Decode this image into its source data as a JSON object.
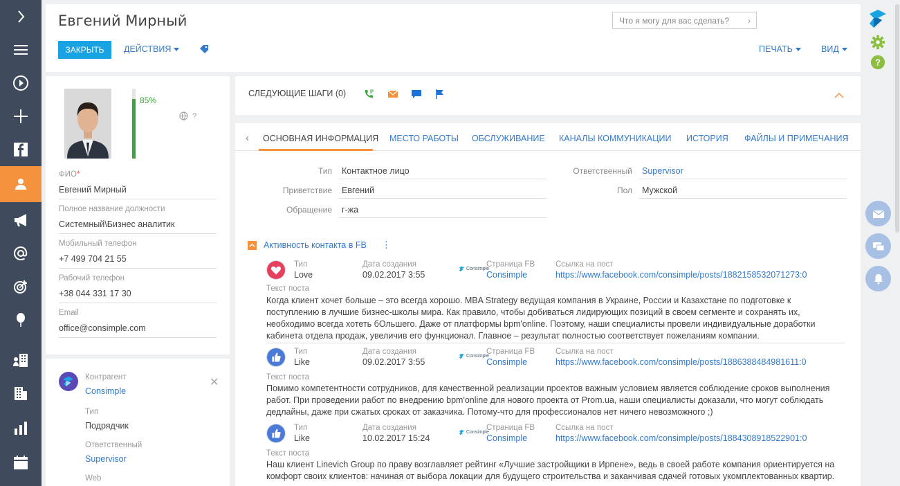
{
  "nav": {
    "items": [
      "expand",
      "menu",
      "processes",
      "add",
      "facebook",
      "contacts",
      "campaigns",
      "email",
      "targets",
      "leads",
      "accounts",
      "buildings",
      "dashboards",
      "calendar"
    ]
  },
  "header": {
    "title": "Евгений Мирный",
    "close_label": "ЗАКРЫТЬ",
    "actions_label": "ДЕЙСТВИЯ",
    "print_label": "ПЕЧАТЬ",
    "view_label": "ВИД",
    "search_placeholder": "Что я могу для вас сделать?"
  },
  "profile": {
    "completeness_pct": 85,
    "completeness_label": "85%",
    "help": "?",
    "fields": [
      {
        "label": "ФИО",
        "required": "*",
        "value": "Евгений Мирный"
      },
      {
        "label": "Полное название должности",
        "value": "Системный\\Бизнес аналитик"
      },
      {
        "label": "Мобильный телефон",
        "value": "+7 499 704 21 55"
      },
      {
        "label": "Рабочий телефон",
        "value": "+38 044 331 17 30"
      },
      {
        "label": "Email",
        "value": "office@consimple.com"
      }
    ]
  },
  "account": {
    "label": "Контрагент",
    "name": "Consimple",
    "type_label": "Тип",
    "type_value": "Подрядчик",
    "owner_label": "Ответственный",
    "owner_value": "Supervisor",
    "web_label": "Web"
  },
  "next_steps": {
    "title": "СЛЕДУЮЩИЕ ШАГИ (0)",
    "icons": [
      "call-icon",
      "email-icon",
      "chat-icon",
      "flag-icon"
    ]
  },
  "tabs": [
    "ОСНОВНАЯ ИНФОРМАЦИЯ",
    "МЕСТО РАБОТЫ",
    "ОБСЛУЖИВАНИЕ",
    "КАНАЛЫ КОММУНИКАЦИИ",
    "ИСТОРИЯ",
    "ФАЙЛЫ И ПРИМЕЧАНИЯ"
  ],
  "info": {
    "type_label": "Тип",
    "type_value": "Контактное лицо",
    "greeting_label": "Приветствие",
    "greeting_value": "Евгений",
    "salutation_label": "Обращение",
    "salutation_value": "г-жа",
    "owner_label": "Ответственный",
    "owner_value": "Supervisor",
    "gender_label": "Пол",
    "gender_value": "Мужской"
  },
  "fb_section": {
    "title": "Активность контакта в FB",
    "col_type": "Тип",
    "col_date": "Дата создания",
    "col_page": "Страница FB",
    "col_link": "Ссылка на пост",
    "col_text": "Текст поста",
    "logo_text": "Consimple",
    "posts": [
      {
        "type": "Love",
        "date": "09.02.2017 3:55",
        "page": "Consimple",
        "link": "https://www.facebook.com/consimple/posts/1882158532071273:0",
        "text": "Когда клиент хочет больше – это всегда хорошо. MBA Strategy ведущая компания в Украине, России и Казахстане по подготовке к поступлению в лучшие бизнес-школы мира. Как правило, чтобы добиваться лидирующих позиций в своем сегменте и сохранять их, необходимо всегда хотеть бОльшего. Даже от платформы bpm'online. Поэтому, наши специалисты провели индивидуальные доработки кабинета отдела продаж, увеличив его функционал. Главное – результат полностью соответствует пожеланиям компании."
      },
      {
        "type": "Like",
        "date": "09.02.2017 3:55",
        "page": "Consimple",
        "link": "https://www.facebook.com/consimple/posts/1886388484981611:0",
        "text": "Помимо компетентности сотрудников, для качественной реализации проектов важным условием является соблюдение сроков выполнения работ. При проведении работ по внедрению bpm'online для нового проекта от Prom.ua, наши специалисты доказали, что могут соблюдать дедлайны, даже при сжатых сроках от заказчика. Потому-что для профессионалов нет ничего невозможного ;)"
      },
      {
        "type": "Like",
        "date": "10.02.2017 15:24",
        "page": "Consimple",
        "link": "https://www.facebook.com/consimple/posts/1884308918522901:0",
        "text": "Наш клиент Linevich Group по праву возглавляет рейтинг «Лучшие застройщики в Ирпене», ведь в своей работе компания ориентируется на комфорт своих клиентов: начиная от выбора локации для будущего строительства и заканчивая сдачей готовых укомплектованных квартир."
      }
    ]
  },
  "colors": {
    "nav_bg": "#3f4a5c",
    "accent": "#f5923e",
    "primary_button": "#1aa3e2",
    "link": "#337acc",
    "progress": "#3aa53a"
  }
}
